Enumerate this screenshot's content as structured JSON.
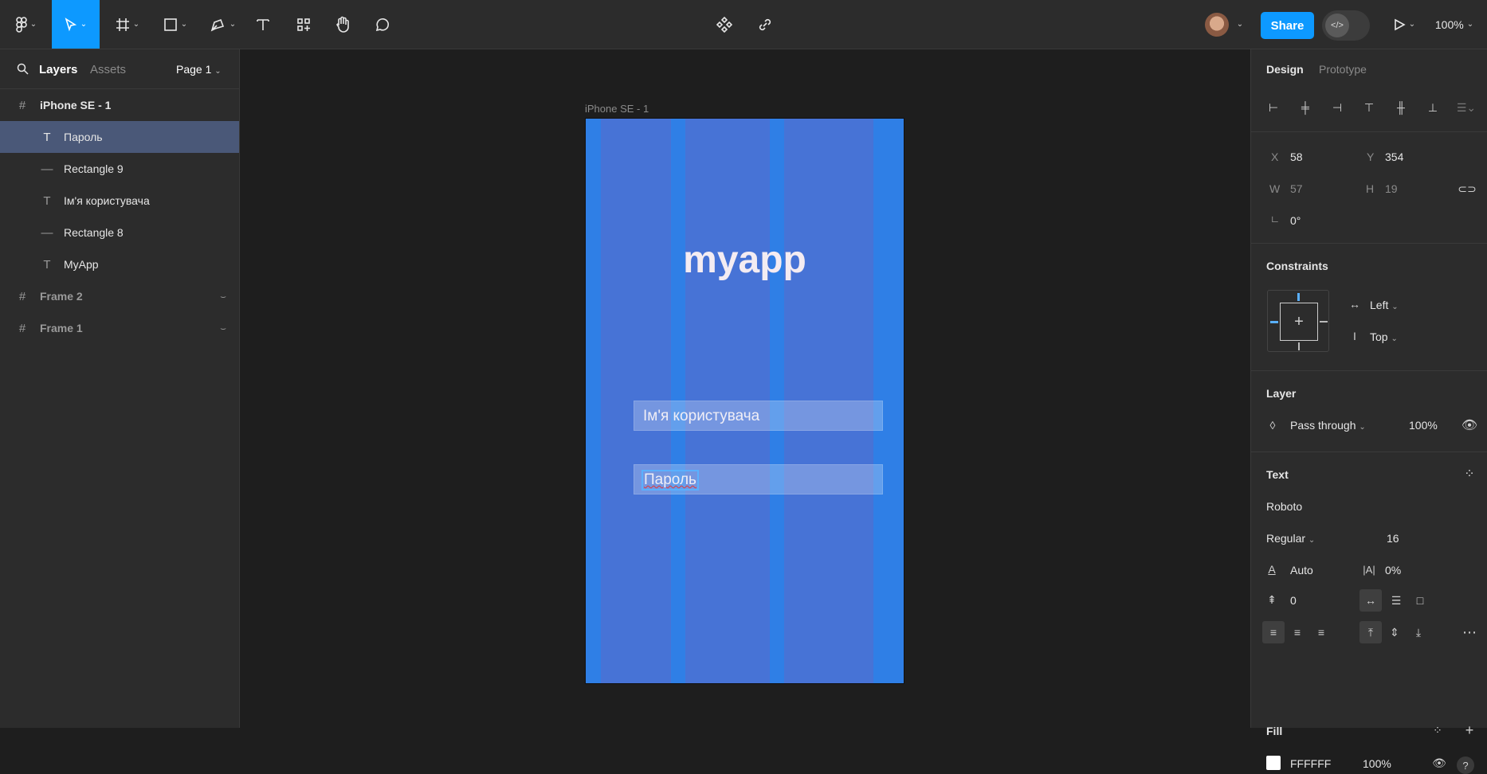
{
  "toolbar": {
    "share_label": "Share",
    "zoom": "100%"
  },
  "left_panel": {
    "tab_layers": "Layers",
    "tab_assets": "Assets",
    "page": "Page 1",
    "layers": [
      {
        "name": "iPhone SE - 1"
      },
      {
        "name": "Пароль"
      },
      {
        "name": "Rectangle 9"
      },
      {
        "name": "Ім'я користувача"
      },
      {
        "name": "Rectangle 8"
      },
      {
        "name": "MyApp"
      },
      {
        "name": "Frame 2"
      },
      {
        "name": "Frame 1"
      }
    ]
  },
  "canvas": {
    "frame_label": "iPhone SE - 1",
    "app_title": "myapp",
    "username_placeholder": "Ім'я користувача",
    "password_placeholder": "Пароль"
  },
  "right_panel": {
    "tab_design": "Design",
    "tab_prototype": "Prototype",
    "position": {
      "x_label": "X",
      "x": "58",
      "y_label": "Y",
      "y": "354",
      "w_label": "W",
      "w": "57",
      "h_label": "H",
      "h": "19",
      "rotation": "0°"
    },
    "constraints": {
      "title": "Constraints",
      "horizontal": "Left",
      "vertical": "Top"
    },
    "layer": {
      "title": "Layer",
      "blend": "Pass through",
      "opacity": "100%"
    },
    "text": {
      "title": "Text",
      "font": "Roboto",
      "weight": "Regular",
      "size": "16",
      "line_height": "Auto",
      "letter_spacing": "0%",
      "paragraph_spacing": "0"
    },
    "fill": {
      "title": "Fill",
      "hex": "FFFFFF",
      "opacity": "100%",
      "color": "#ffffff"
    }
  },
  "colors": {
    "accent": "#0d99ff",
    "frame_bg": "#2f7fe6",
    "layout_column": "#4773d6",
    "selected_layer": "#4a5878"
  }
}
